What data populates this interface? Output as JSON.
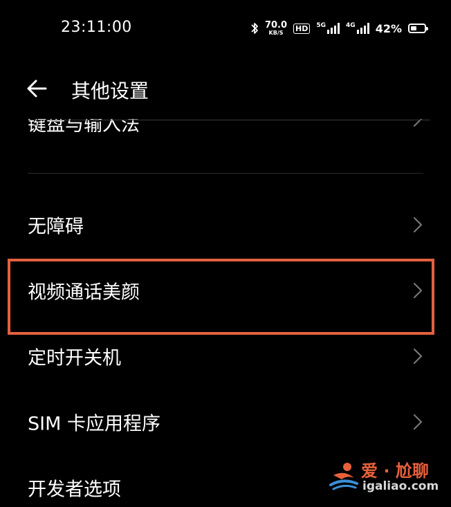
{
  "status_bar": {
    "time": "23:11:00",
    "network_speed_value": "70.0",
    "network_speed_unit": "KB/S",
    "hd_label": "HD",
    "sim1_type": "5G",
    "sim2_type": "4G",
    "battery_percent": "42%",
    "battery_level": 0.42,
    "icons": [
      "bluetooth-icon",
      "hd-voice-icon",
      "signal-5g-icon",
      "signal-4g-icon",
      "battery-icon"
    ]
  },
  "header": {
    "back_icon": "back-arrow-icon",
    "title": "其他设置"
  },
  "settings": {
    "partial_item": "键盘与输入法",
    "items": [
      {
        "label": "无障碍"
      },
      {
        "label": "视频通话美颜"
      },
      {
        "label": "定时开关机"
      },
      {
        "label": "SIM 卡应用程序"
      },
      {
        "label": "开发者选项"
      }
    ]
  },
  "highlight_color": "#e3603f",
  "watermark": {
    "top": "爱 · 尬聊",
    "bottom": "igaliao.com",
    "color": "#e8603b"
  }
}
